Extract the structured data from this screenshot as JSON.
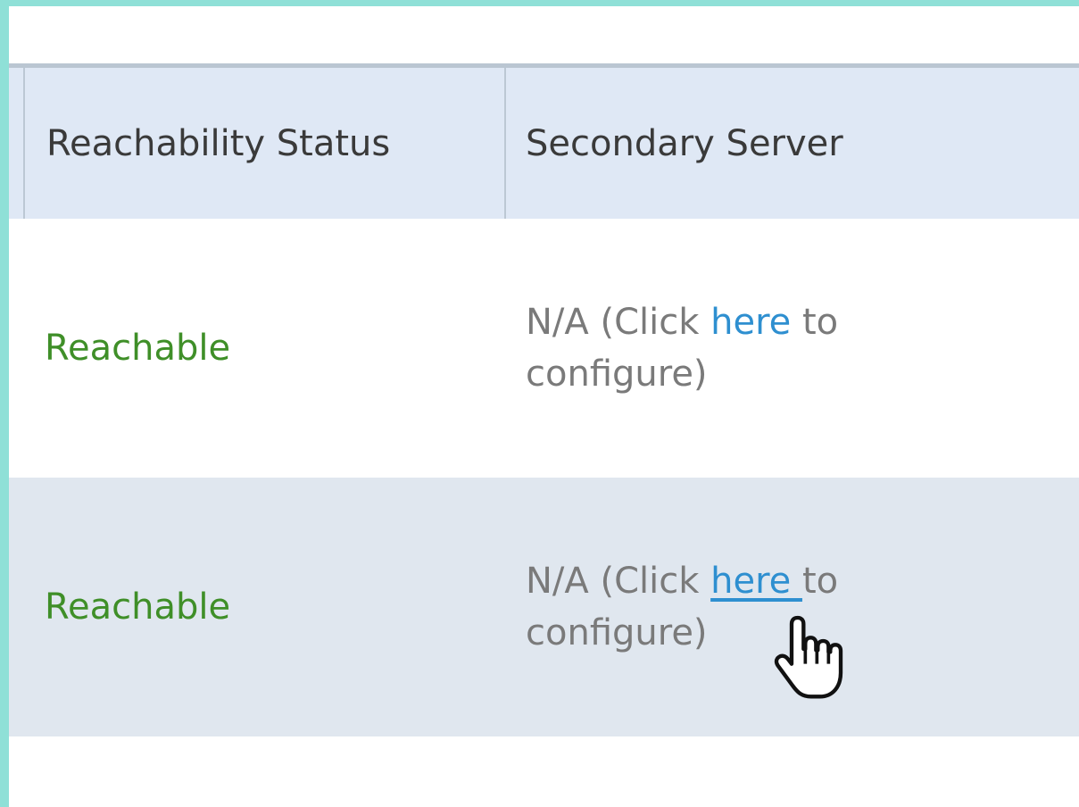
{
  "table": {
    "headers": {
      "reachability_status": "Reachability Status",
      "secondary_server": "Secondary Server"
    },
    "rows": [
      {
        "status": "Reachable",
        "secondary_prefix": "N/A (Click ",
        "secondary_link": "here",
        "secondary_suffix": " to configure)"
      },
      {
        "status": "Reachable",
        "secondary_prefix": "N/A (Click ",
        "secondary_link": "here ",
        "secondary_suffix": "to configure)"
      }
    ]
  },
  "colors": {
    "frame_border": "#8fe0d7",
    "header_background": "#dfe8f5",
    "alt_row_background": "#e0e7ef",
    "status_reachable": "#3f8f28",
    "link": "#2e8fd0",
    "muted_text": "#7a7a7a"
  },
  "cursor": {
    "icon": "hand-pointer-icon"
  }
}
